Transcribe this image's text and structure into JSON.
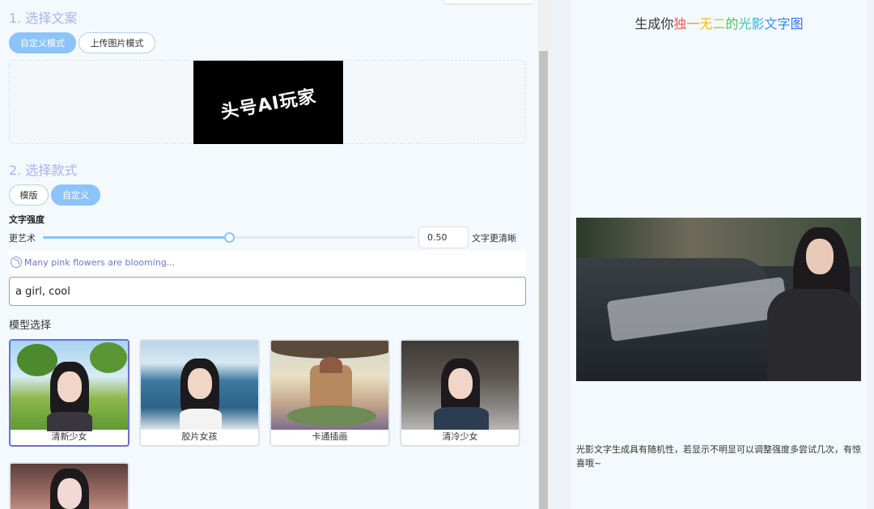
{
  "step1": {
    "title": "1. 选择文案",
    "mode_buttons": [
      "自定义模式",
      "上传图片模式"
    ],
    "preview_text": "头号AI玩家"
  },
  "step2": {
    "title": "2. 选择款式",
    "style_buttons": [
      "模版",
      "自定义"
    ]
  },
  "strength": {
    "label": "文字强度",
    "left_label": "更艺术",
    "right_label": "文字更清晰",
    "value": "0.50",
    "fraction": 0.5
  },
  "prompt": {
    "hint": "Many pink flowers are blooming...",
    "value": "a girl, cool"
  },
  "models": {
    "label": "模型选择",
    "items": [
      "清新少女",
      "胶片女孩",
      "卡通插画",
      "清冷少女"
    ]
  },
  "right": {
    "title_plain": "生成你",
    "title_colored": [
      "独",
      "一",
      "无",
      "二",
      "的",
      "光",
      "影",
      "文",
      "字",
      "图"
    ],
    "title_colors": [
      "#f2585b",
      "#f58a3a",
      "#f5b920",
      "#9ad242",
      "#4cc35f",
      "#3dc6a7",
      "#2eb4e0",
      "#3a8ef0",
      "#2e7ff0",
      "#3a6ff0"
    ],
    "note": "光影文字生成具有随机性，若显示不明显可以调整强度多尝试几次，有惊喜哦~"
  },
  "colors": {
    "accent": "#8cc3f8",
    "section_title": "#a9b4e8",
    "selected_border": "#6b6fd0"
  }
}
